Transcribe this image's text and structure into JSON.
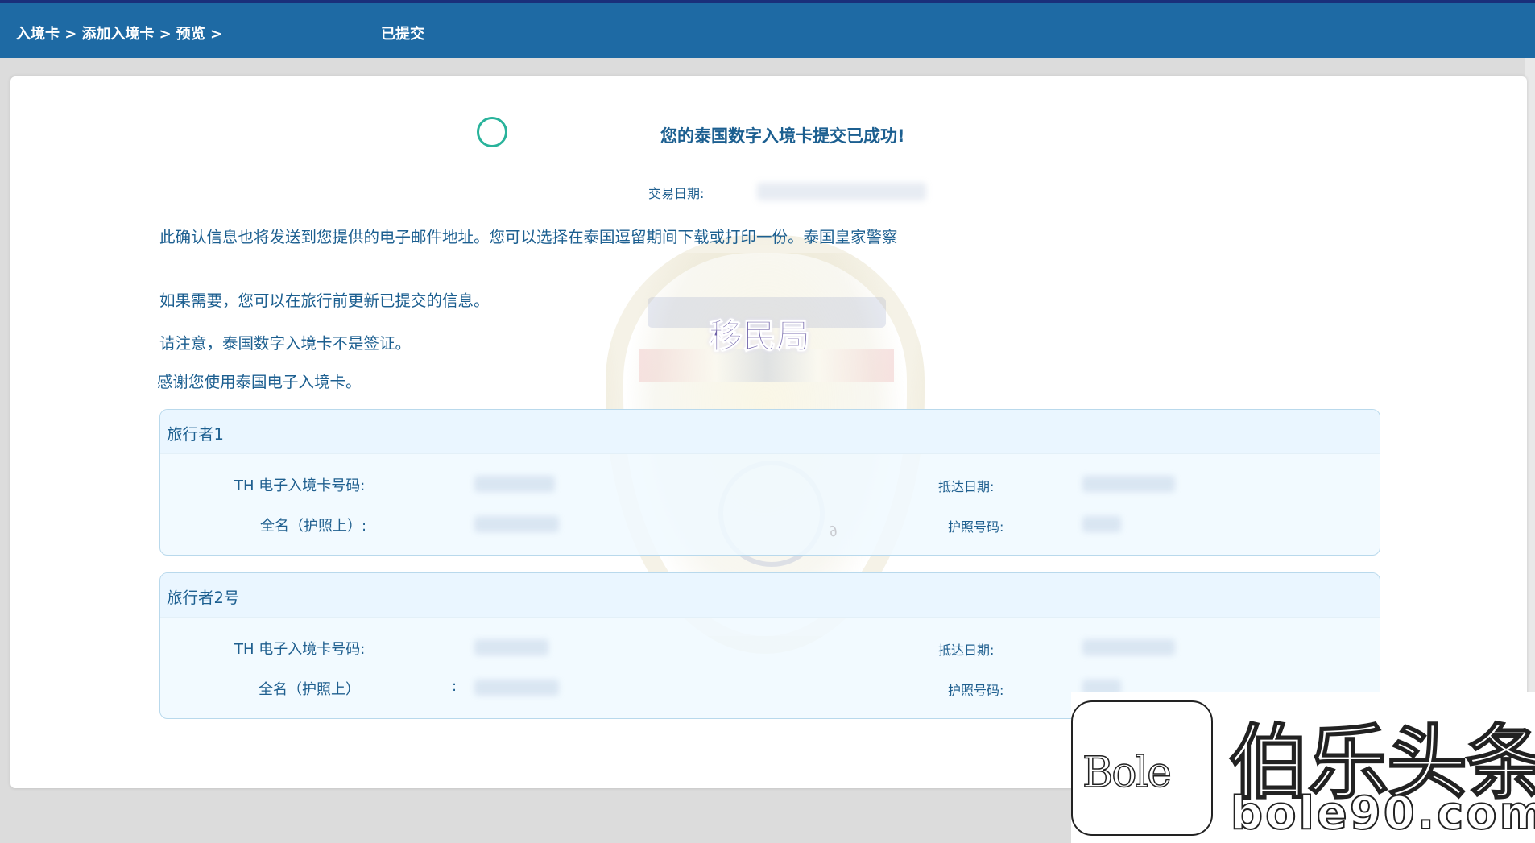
{
  "breadcrumb": {
    "items": [
      "入境卡 >",
      "添加入境卡 >",
      "预览 >"
    ],
    "current": "已提交"
  },
  "main": {
    "success_message": "您的泰国数字入境卡提交已成功!",
    "transaction_date_label": "交易日期:",
    "paragraphs": {
      "confirmation": "此确认信息也将发送到您提供的电子邮件地址。您可以选择在泰国逗留期间下载或打印一份。泰国皇家警察",
      "update_note": "如果需要，您可以在旅行前更新已提交的信息。",
      "visa_note": "请注意，泰国数字入境卡不是签证。",
      "thanks": "感谢您使用泰国电子入境卡。"
    },
    "emblem_title": "移民局"
  },
  "travelers": [
    {
      "title": "旅行者1",
      "card_no_label": "TH 电子入境卡号码:",
      "fullname_label": "全名（护照上）:",
      "arrival_label": "抵达日期:",
      "passport_label": "护照号码:"
    },
    {
      "title": "旅行者2号",
      "card_no_label": "TH 电子入境卡号码:",
      "fullname_label": "全名（护照上）",
      "fullname_colon": ":",
      "arrival_label": "抵达日期:",
      "passport_label": "护照号码:"
    }
  ],
  "watermark": {
    "logo_text": "Bole",
    "chinese": "伯乐头条",
    "url": "bole90.com"
  },
  "colors": {
    "header": "#1e6aa4",
    "accent_text": "#1c5f90",
    "success": "#29b39b"
  }
}
